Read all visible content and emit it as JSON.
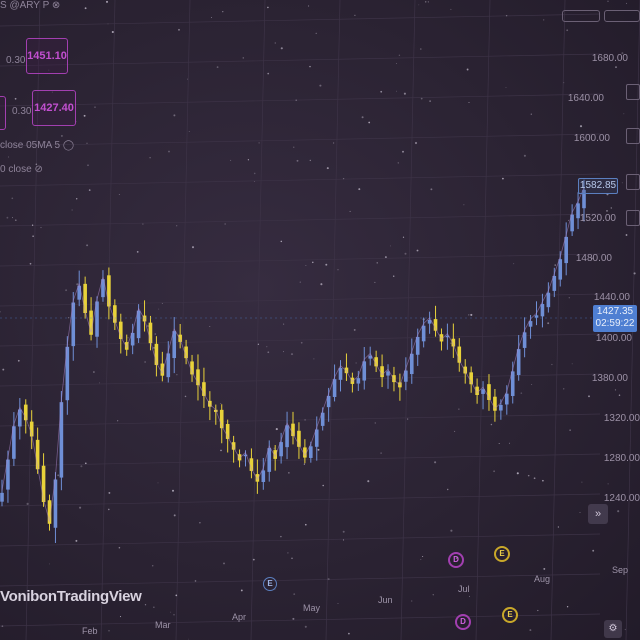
{
  "legend": {
    "symbol_text": "S @ARY P",
    "row1_prefix": "0.30",
    "row1_value": "1451.10",
    "row2_prefix": "0.30",
    "row2_value": "1427.40",
    "ma_label": "close 05MA 5",
    "close_label": "0 close"
  },
  "price_axis": {
    "labels": [
      "1680.00",
      "1640.00",
      "1600.00",
      "1520.00",
      "1480.00",
      "1440.00",
      "1400.00",
      "1380.00",
      "1320.00",
      "1280.00",
      "1240.00"
    ],
    "top_tag": "1582.85",
    "last_price": "1427.35",
    "countdown": "02:59:22"
  },
  "time_axis": {
    "months": [
      "Feb",
      "Mar",
      "Apr",
      "May",
      "Jun",
      "Jul",
      "Aug",
      "Sep"
    ]
  },
  "events": {
    "e1": "E",
    "e2": "D",
    "e3": "E",
    "e4": "D",
    "e5": "E"
  },
  "logo_text": "VonibonTradingView",
  "nav_symbol": "»",
  "colors": {
    "up_candle": "#6f8fd6",
    "down_candle": "#e8d23a",
    "background": "#2b2333",
    "accent_purple": "#a23fb0",
    "last_price_bg": "#4f7fd2"
  },
  "chart_data": {
    "type": "candlestick",
    "ylim": [
      1280,
      1700
    ],
    "closes": [
      1330,
      1360,
      1390,
      1405,
      1395,
      1380,
      1350,
      1320,
      1300,
      1340,
      1410,
      1460,
      1500,
      1515,
      1490,
      1470,
      1500,
      1520,
      1495,
      1480,
      1465,
      1455,
      1470,
      1490,
      1480,
      1460,
      1440,
      1430,
      1450,
      1470,
      1460,
      1445,
      1430,
      1420,
      1410,
      1400,
      1395,
      1380,
      1370,
      1360,
      1350,
      1355,
      1340,
      1330,
      1340,
      1360,
      1350,
      1365,
      1380,
      1370,
      1360,
      1350,
      1360,
      1375,
      1390,
      1405,
      1420,
      1430,
      1425,
      1415,
      1420,
      1435,
      1440,
      1430,
      1420,
      1425,
      1415,
      1410,
      1425,
      1440,
      1455,
      1465,
      1470,
      1460,
      1450,
      1455,
      1445,
      1430,
      1420,
      1410,
      1400,
      1405,
      1395,
      1385,
      1390,
      1400,
      1420,
      1440,
      1455,
      1465,
      1470,
      1480,
      1490,
      1505,
      1520,
      1540,
      1560,
      1570,
      1582
    ]
  }
}
